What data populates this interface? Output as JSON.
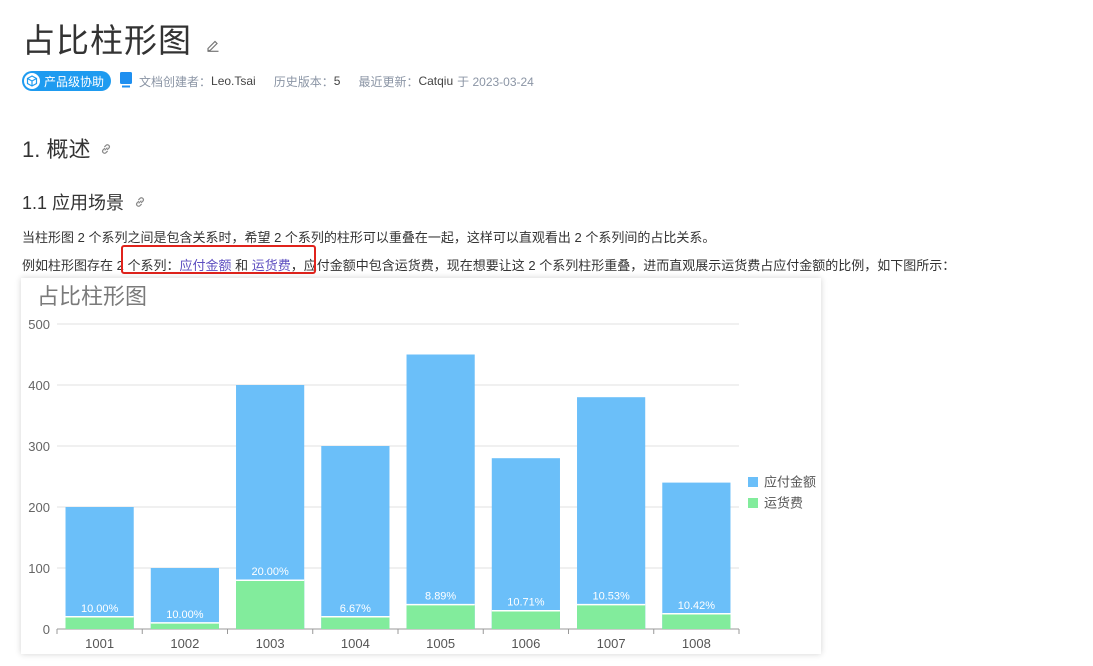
{
  "page": {
    "title": "占比柱形图"
  },
  "meta": {
    "badge": "产品级协助",
    "creator_label": "文档创建者：",
    "creator": "Leo.Tsai",
    "history_label": "历史版本：",
    "history": "5",
    "updated_label": "最近更新：",
    "updated_by": "Catqiu",
    "updated_date": "于 2023-03-24"
  },
  "sections": {
    "h1": "1. 概述",
    "h2": "1.1 应用场景"
  },
  "paragraphs": {
    "p1": "当柱形图 2 个系列之间是包含关系时，希望 2 个系列的柱形可以重叠在一起，这样可以直观看出 2 个系列间的占比关系。",
    "p2_a": "例如柱形图存在 2 个系列：",
    "p2_s1": "应付金额",
    "p2_and": " 和 ",
    "p2_s2": "运货费",
    "p2_b": "，应付金额中包含运货费，现在想要让这 2 个系列柱形重叠，进而直观展示运货费占应付金额的比例，如下图所示："
  },
  "colors": {
    "series1": "#6bbff9",
    "series2": "#82ec9c",
    "badge": "#1e9bf0",
    "highlight_box": "#e0231c"
  },
  "chart_data": {
    "type": "bar",
    "title": "占比柱形图",
    "categories": [
      "1001",
      "1002",
      "1003",
      "1004",
      "1005",
      "1006",
      "1007",
      "1008"
    ],
    "series": [
      {
        "name": "应付金额",
        "values": [
          200,
          100,
          400,
          300,
          450,
          280,
          380,
          240
        ]
      },
      {
        "name": "运货费",
        "values": [
          20,
          10,
          80,
          20,
          40,
          30,
          40,
          25
        ]
      }
    ],
    "data_labels": [
      "10.00%",
      "10.00%",
      "20.00%",
      "6.67%",
      "8.89%",
      "10.71%",
      "10.53%",
      "10.42%"
    ],
    "ylim": [
      0,
      500
    ],
    "yticks": [
      0,
      100,
      200,
      300,
      400,
      500
    ],
    "grid": true,
    "legend": "right",
    "overlap": true
  }
}
